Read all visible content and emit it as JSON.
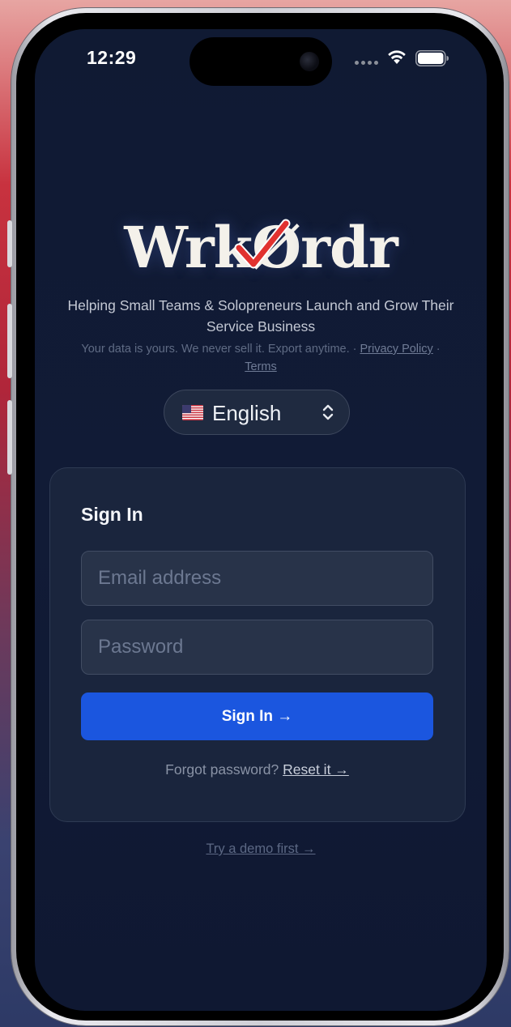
{
  "status_bar": {
    "time": "12:29"
  },
  "brand": {
    "logo_text_left": "Wrk",
    "logo_text_right": "rdr",
    "logo_o": "Ø",
    "tagline": "Helping Small Teams & Solopreneurs Launch and Grow Their Service Business",
    "privacy_text": "Your data is yours. We never sell it. Export anytime. · ",
    "privacy_link": "Privacy Policy",
    "separator": " · ",
    "terms_link": "Terms",
    "check_color": "#e1322f"
  },
  "language": {
    "flag": "us-flag",
    "selected": "English"
  },
  "signin": {
    "title": "Sign In",
    "email_placeholder": "Email address",
    "password_placeholder": "Password",
    "button_label": "Sign In →",
    "forgot_text": "Forgot password? ",
    "reset_link": "Reset it →",
    "accent_color": "#1b56df"
  },
  "demo_link": "Try a demo first →"
}
